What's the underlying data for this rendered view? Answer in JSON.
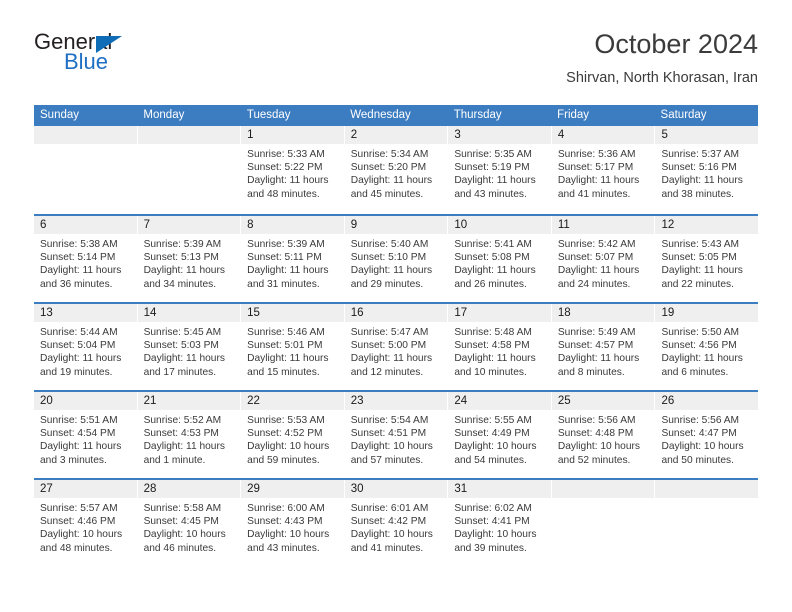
{
  "logo": {
    "word1": "General",
    "word2": "Blue",
    "triangle_icon": "blue-triangle-icon"
  },
  "header": {
    "title": "October 2024",
    "subtitle": "Shirvan, North Khorasan, Iran"
  },
  "colors": {
    "header_blue": "#3c7cc0",
    "day_band_gray": "#efefef",
    "logo_blue": "#1f6fc4",
    "text_dark": "#3b3b3b"
  },
  "calendar": {
    "weekday_headers": [
      "Sunday",
      "Monday",
      "Tuesday",
      "Wednesday",
      "Thursday",
      "Friday",
      "Saturday"
    ],
    "labels": {
      "sunrise": "Sunrise:",
      "sunset": "Sunset:",
      "daylight": "Daylight:"
    },
    "weeks": [
      [
        {
          "day": "",
          "empty": true
        },
        {
          "day": "",
          "empty": true
        },
        {
          "day": "1",
          "sunrise": "Sunrise: 5:33 AM",
          "sunset": "Sunset: 5:22 PM",
          "daylight_1": "Daylight: 11 hours",
          "daylight_2": "and 48 minutes."
        },
        {
          "day": "2",
          "sunrise": "Sunrise: 5:34 AM",
          "sunset": "Sunset: 5:20 PM",
          "daylight_1": "Daylight: 11 hours",
          "daylight_2": "and 45 minutes."
        },
        {
          "day": "3",
          "sunrise": "Sunrise: 5:35 AM",
          "sunset": "Sunset: 5:19 PM",
          "daylight_1": "Daylight: 11 hours",
          "daylight_2": "and 43 minutes."
        },
        {
          "day": "4",
          "sunrise": "Sunrise: 5:36 AM",
          "sunset": "Sunset: 5:17 PM",
          "daylight_1": "Daylight: 11 hours",
          "daylight_2": "and 41 minutes."
        },
        {
          "day": "5",
          "sunrise": "Sunrise: 5:37 AM",
          "sunset": "Sunset: 5:16 PM",
          "daylight_1": "Daylight: 11 hours",
          "daylight_2": "and 38 minutes."
        }
      ],
      [
        {
          "day": "6",
          "sunrise": "Sunrise: 5:38 AM",
          "sunset": "Sunset: 5:14 PM",
          "daylight_1": "Daylight: 11 hours",
          "daylight_2": "and 36 minutes."
        },
        {
          "day": "7",
          "sunrise": "Sunrise: 5:39 AM",
          "sunset": "Sunset: 5:13 PM",
          "daylight_1": "Daylight: 11 hours",
          "daylight_2": "and 34 minutes."
        },
        {
          "day": "8",
          "sunrise": "Sunrise: 5:39 AM",
          "sunset": "Sunset: 5:11 PM",
          "daylight_1": "Daylight: 11 hours",
          "daylight_2": "and 31 minutes."
        },
        {
          "day": "9",
          "sunrise": "Sunrise: 5:40 AM",
          "sunset": "Sunset: 5:10 PM",
          "daylight_1": "Daylight: 11 hours",
          "daylight_2": "and 29 minutes."
        },
        {
          "day": "10",
          "sunrise": "Sunrise: 5:41 AM",
          "sunset": "Sunset: 5:08 PM",
          "daylight_1": "Daylight: 11 hours",
          "daylight_2": "and 26 minutes."
        },
        {
          "day": "11",
          "sunrise": "Sunrise: 5:42 AM",
          "sunset": "Sunset: 5:07 PM",
          "daylight_1": "Daylight: 11 hours",
          "daylight_2": "and 24 minutes."
        },
        {
          "day": "12",
          "sunrise": "Sunrise: 5:43 AM",
          "sunset": "Sunset: 5:05 PM",
          "daylight_1": "Daylight: 11 hours",
          "daylight_2": "and 22 minutes."
        }
      ],
      [
        {
          "day": "13",
          "sunrise": "Sunrise: 5:44 AM",
          "sunset": "Sunset: 5:04 PM",
          "daylight_1": "Daylight: 11 hours",
          "daylight_2": "and 19 minutes."
        },
        {
          "day": "14",
          "sunrise": "Sunrise: 5:45 AM",
          "sunset": "Sunset: 5:03 PM",
          "daylight_1": "Daylight: 11 hours",
          "daylight_2": "and 17 minutes."
        },
        {
          "day": "15",
          "sunrise": "Sunrise: 5:46 AM",
          "sunset": "Sunset: 5:01 PM",
          "daylight_1": "Daylight: 11 hours",
          "daylight_2": "and 15 minutes."
        },
        {
          "day": "16",
          "sunrise": "Sunrise: 5:47 AM",
          "sunset": "Sunset: 5:00 PM",
          "daylight_1": "Daylight: 11 hours",
          "daylight_2": "and 12 minutes."
        },
        {
          "day": "17",
          "sunrise": "Sunrise: 5:48 AM",
          "sunset": "Sunset: 4:58 PM",
          "daylight_1": "Daylight: 11 hours",
          "daylight_2": "and 10 minutes."
        },
        {
          "day": "18",
          "sunrise": "Sunrise: 5:49 AM",
          "sunset": "Sunset: 4:57 PM",
          "daylight_1": "Daylight: 11 hours",
          "daylight_2": "and 8 minutes."
        },
        {
          "day": "19",
          "sunrise": "Sunrise: 5:50 AM",
          "sunset": "Sunset: 4:56 PM",
          "daylight_1": "Daylight: 11 hours",
          "daylight_2": "and 6 minutes."
        }
      ],
      [
        {
          "day": "20",
          "sunrise": "Sunrise: 5:51 AM",
          "sunset": "Sunset: 4:54 PM",
          "daylight_1": "Daylight: 11 hours",
          "daylight_2": "and 3 minutes."
        },
        {
          "day": "21",
          "sunrise": "Sunrise: 5:52 AM",
          "sunset": "Sunset: 4:53 PM",
          "daylight_1": "Daylight: 11 hours",
          "daylight_2": "and 1 minute."
        },
        {
          "day": "22",
          "sunrise": "Sunrise: 5:53 AM",
          "sunset": "Sunset: 4:52 PM",
          "daylight_1": "Daylight: 10 hours",
          "daylight_2": "and 59 minutes."
        },
        {
          "day": "23",
          "sunrise": "Sunrise: 5:54 AM",
          "sunset": "Sunset: 4:51 PM",
          "daylight_1": "Daylight: 10 hours",
          "daylight_2": "and 57 minutes."
        },
        {
          "day": "24",
          "sunrise": "Sunrise: 5:55 AM",
          "sunset": "Sunset: 4:49 PM",
          "daylight_1": "Daylight: 10 hours",
          "daylight_2": "and 54 minutes."
        },
        {
          "day": "25",
          "sunrise": "Sunrise: 5:56 AM",
          "sunset": "Sunset: 4:48 PM",
          "daylight_1": "Daylight: 10 hours",
          "daylight_2": "and 52 minutes."
        },
        {
          "day": "26",
          "sunrise": "Sunrise: 5:56 AM",
          "sunset": "Sunset: 4:47 PM",
          "daylight_1": "Daylight: 10 hours",
          "daylight_2": "and 50 minutes."
        }
      ],
      [
        {
          "day": "27",
          "sunrise": "Sunrise: 5:57 AM",
          "sunset": "Sunset: 4:46 PM",
          "daylight_1": "Daylight: 10 hours",
          "daylight_2": "and 48 minutes."
        },
        {
          "day": "28",
          "sunrise": "Sunrise: 5:58 AM",
          "sunset": "Sunset: 4:45 PM",
          "daylight_1": "Daylight: 10 hours",
          "daylight_2": "and 46 minutes."
        },
        {
          "day": "29",
          "sunrise": "Sunrise: 6:00 AM",
          "sunset": "Sunset: 4:43 PM",
          "daylight_1": "Daylight: 10 hours",
          "daylight_2": "and 43 minutes."
        },
        {
          "day": "30",
          "sunrise": "Sunrise: 6:01 AM",
          "sunset": "Sunset: 4:42 PM",
          "daylight_1": "Daylight: 10 hours",
          "daylight_2": "and 41 minutes."
        },
        {
          "day": "31",
          "sunrise": "Sunrise: 6:02 AM",
          "sunset": "Sunset: 4:41 PM",
          "daylight_1": "Daylight: 10 hours",
          "daylight_2": "and 39 minutes."
        },
        {
          "day": "",
          "empty": true
        },
        {
          "day": "",
          "empty": true
        }
      ]
    ]
  }
}
